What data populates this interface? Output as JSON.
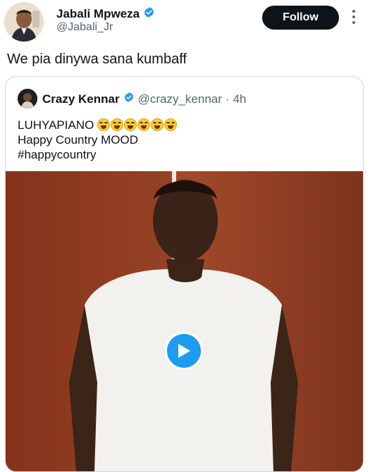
{
  "author": {
    "name": "Jabali Mpweza",
    "handle": "@Jabali_Jr",
    "verified_icon": "verified-badge-icon"
  },
  "follow_label": "Follow",
  "tweet_text": "We pia dinywa sana kumbaff",
  "quoted": {
    "name": "Crazy Kennar",
    "handle": "@crazy_kennar",
    "separator": "·",
    "time": "4h",
    "line1": "LUHYAPIANO",
    "emoji_count": 6,
    "line2": "Happy Country MOOD",
    "line3": "#happycountry"
  },
  "colors": {
    "accent": "#1d9bf0",
    "follow_bg": "#0f1419",
    "text_secondary": "#536471"
  }
}
